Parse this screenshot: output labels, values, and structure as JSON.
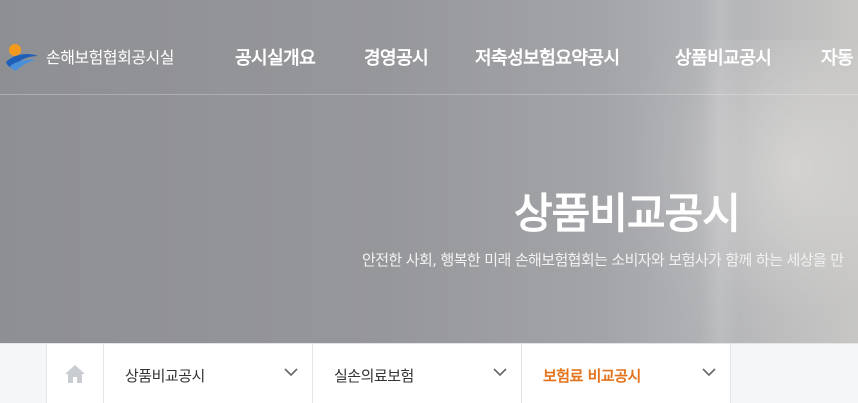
{
  "header": {
    "logo_text": "손해보험협회공시실",
    "menu": [
      {
        "label": "공시실개요"
      },
      {
        "label": "경영공시"
      },
      {
        "label": "저축성보험요약공시"
      },
      {
        "label": "상품비교공시"
      },
      {
        "label": "자동"
      }
    ]
  },
  "hero": {
    "title": "상품비교공시",
    "subtitle": "안전한 사회, 행복한 미래 손해보험협회는 소비자와 보험사가 함께 하는 세상을 만"
  },
  "breadcrumb": {
    "home_icon": "home-icon",
    "items": [
      {
        "label": "상품비교공시",
        "active": false
      },
      {
        "label": "실손의료보험",
        "active": false
      },
      {
        "label": "보험료 비교공시",
        "active": true
      }
    ]
  },
  "colors": {
    "accent": "#e4731c",
    "logo_orange": "#f39a1e",
    "logo_blue": "#1f5fb8"
  }
}
